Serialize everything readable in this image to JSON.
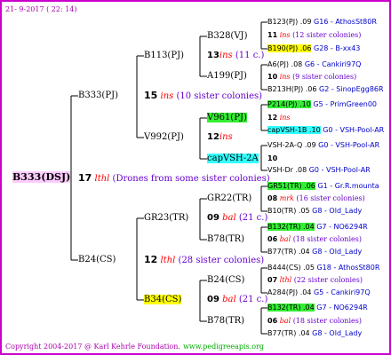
{
  "header": {
    "date": "21-  9-2017 ( 22: 14)"
  },
  "footer": {
    "copyright": "Copyright 2004-2017 @ Karl Kehrle Foundation.",
    "url": "www.pedigreeapis.org"
  },
  "root": {
    "name": "B333(DSJ)",
    "gen": "17",
    "note": "lthl",
    "sisters": "(Drones from some sister colonies)"
  },
  "p1": {
    "name": "B333(PJ)",
    "gen": "15",
    "note": "ins",
    "sisters": "(10 sister colonies)"
  },
  "m1": {
    "name": "B24(CS)",
    "gen": "12",
    "note": "lthl",
    "sisters": "(28 sister colonies)"
  },
  "pp": {
    "name": "B113(PJ)",
    "gen": "13",
    "note": "ins",
    "sisters": "(11 c.)"
  },
  "pm": {
    "name": "V992(PJ)",
    "gen": "12",
    "note": "ins"
  },
  "mp": {
    "name": "GR23(TR)",
    "gen": "09",
    "note": "bal",
    "sisters": "(21 c.)"
  },
  "mm": {
    "name": "B34(CS)",
    "gen": "09",
    "note": "bal",
    "sisters": "(21 c.)"
  },
  "ppp": {
    "name": "B328(VJ)"
  },
  "ppm": {
    "name": "A199(PJ)"
  },
  "pmp": {
    "name": "V961(PJ)"
  },
  "pmm": {
    "name": "capVSH-2A"
  },
  "mpp": {
    "name": "GR22(TR)"
  },
  "mpm": {
    "name": "B78(TR)"
  },
  "mmp": {
    "name": "B24(CS)"
  },
  "mmm": {
    "name": "B78(TR)"
  },
  "g4": [
    {
      "a": "B123(PJ) .09",
      "b": "G16 - AthosSt80R"
    },
    {
      "a": "11",
      "note": "ins",
      "b": "(12 sister colonies)"
    },
    {
      "a": "B190(PJ) .06",
      "b": "G28 - B-xx43"
    },
    {
      "a": "A6(PJ) .08",
      "b": "G6 - Cankiri97Q"
    },
    {
      "a": "10",
      "note": "ins",
      "b": "(9 sister colonies)"
    },
    {
      "a": "B213H(PJ) .06",
      "b": "G2 - SinopEgg86R"
    },
    {
      "a": "P214(PJ) .10",
      "b": "G5 - PrimGreen00"
    },
    {
      "a": "12",
      "note": "ins"
    },
    {
      "a": "capVSH-1B .10",
      "b": "G0 - VSH-Pool-AR"
    },
    {
      "a": "VSH-2A-Q .09",
      "b": "G0 - VSH-Pool-AR"
    },
    {
      "a": "10"
    },
    {
      "a": "VSH-Dr .08",
      "b": "G0 - VSH-Pool-AR"
    },
    {
      "a": "GR51(TR) .06",
      "b": "G1 - Gr.R.mounta"
    },
    {
      "a": "08",
      "note": "mrk",
      "b": "(16 sister colonies)"
    },
    {
      "a": "B10(TR) .05",
      "b": "G8 - Old_Lady"
    },
    {
      "a": "B132(TR) .04",
      "b": "G7 - NO6294R"
    },
    {
      "a": "06",
      "note": "bal",
      "b": "(18 sister colonies)"
    },
    {
      "a": "B77(TR) .04",
      "b": "G8 - Old_Lady"
    },
    {
      "a": "B444(CS) .05",
      "b": "G18 - AthosSt80R"
    },
    {
      "a": "07",
      "note": "lthl",
      "b": "(22 sister colonies)"
    },
    {
      "a": "A284(PJ) .04",
      "b": "G5 - Cankiri97Q"
    },
    {
      "a": "B132(TR) .04",
      "b": "G7 - NO6294R"
    },
    {
      "a": "06",
      "note": "bal",
      "b": "(18 sister colonies)"
    },
    {
      "a": "B77(TR) .04",
      "b": "G8 - Old_Lady"
    }
  ]
}
